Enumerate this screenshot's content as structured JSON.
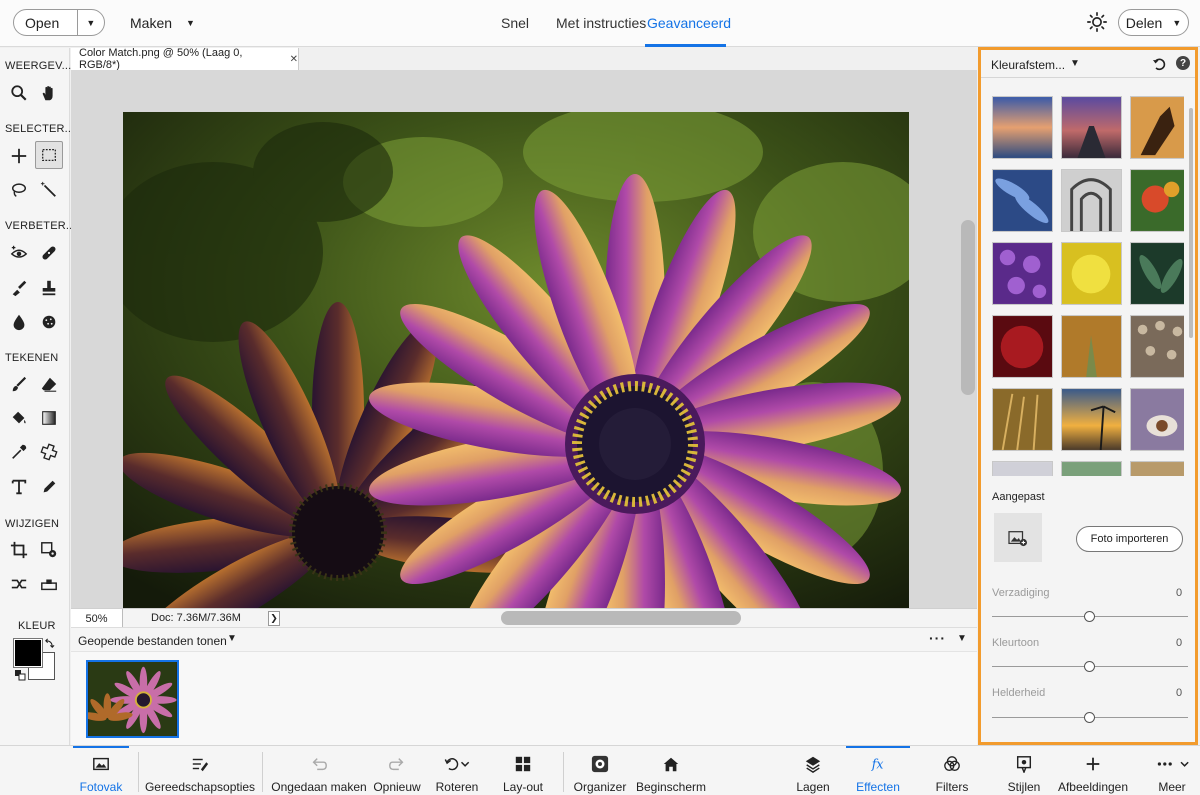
{
  "topbar": {
    "open_label": "Open",
    "maken_label": "Maken",
    "modes": [
      "Snel",
      "Met instructies",
      "Geavanceerd"
    ],
    "active_mode": "Geavanceerd",
    "delen_label": "Delen",
    "accent_color": "#1473e6"
  },
  "toolbar": {
    "sections": [
      "WEERGEV...",
      "SELECTER...",
      "VERBETER...",
      "TEKENEN",
      "WIJZIGEN",
      "KLEUR"
    ],
    "foreground_color": "#000000",
    "background_color": "#ffffff"
  },
  "document": {
    "tab_title": "Color Match.png @ 50% (Laag 0, RGB/8*)",
    "zoom": "50%",
    "doc_size": "Doc: 7.36M/7.36M"
  },
  "photo_bin": {
    "title": "Geopende bestanden tonen"
  },
  "panel": {
    "title": "Kleurafstem...",
    "border_color": "#f29b2d",
    "custom_label": "Aangepast",
    "import_label": "Foto importeren",
    "sliders": [
      {
        "label": "Verzadiging",
        "value": "0"
      },
      {
        "label": "Kleurtoon",
        "value": "0"
      },
      {
        "label": "Helderheid",
        "value": "0"
      }
    ]
  },
  "bottombar": {
    "items": [
      "Fotovak",
      "Gereedschapsopties",
      "Ongedaan maken",
      "Opnieuw",
      "Roteren",
      "Lay-out",
      "Organizer",
      "Beginscherm",
      "Lagen",
      "Effecten",
      "Filters",
      "Stijlen",
      "Afbeeldingen",
      "Meer"
    ],
    "active_left": "Fotovak",
    "active_right": "Effecten"
  }
}
